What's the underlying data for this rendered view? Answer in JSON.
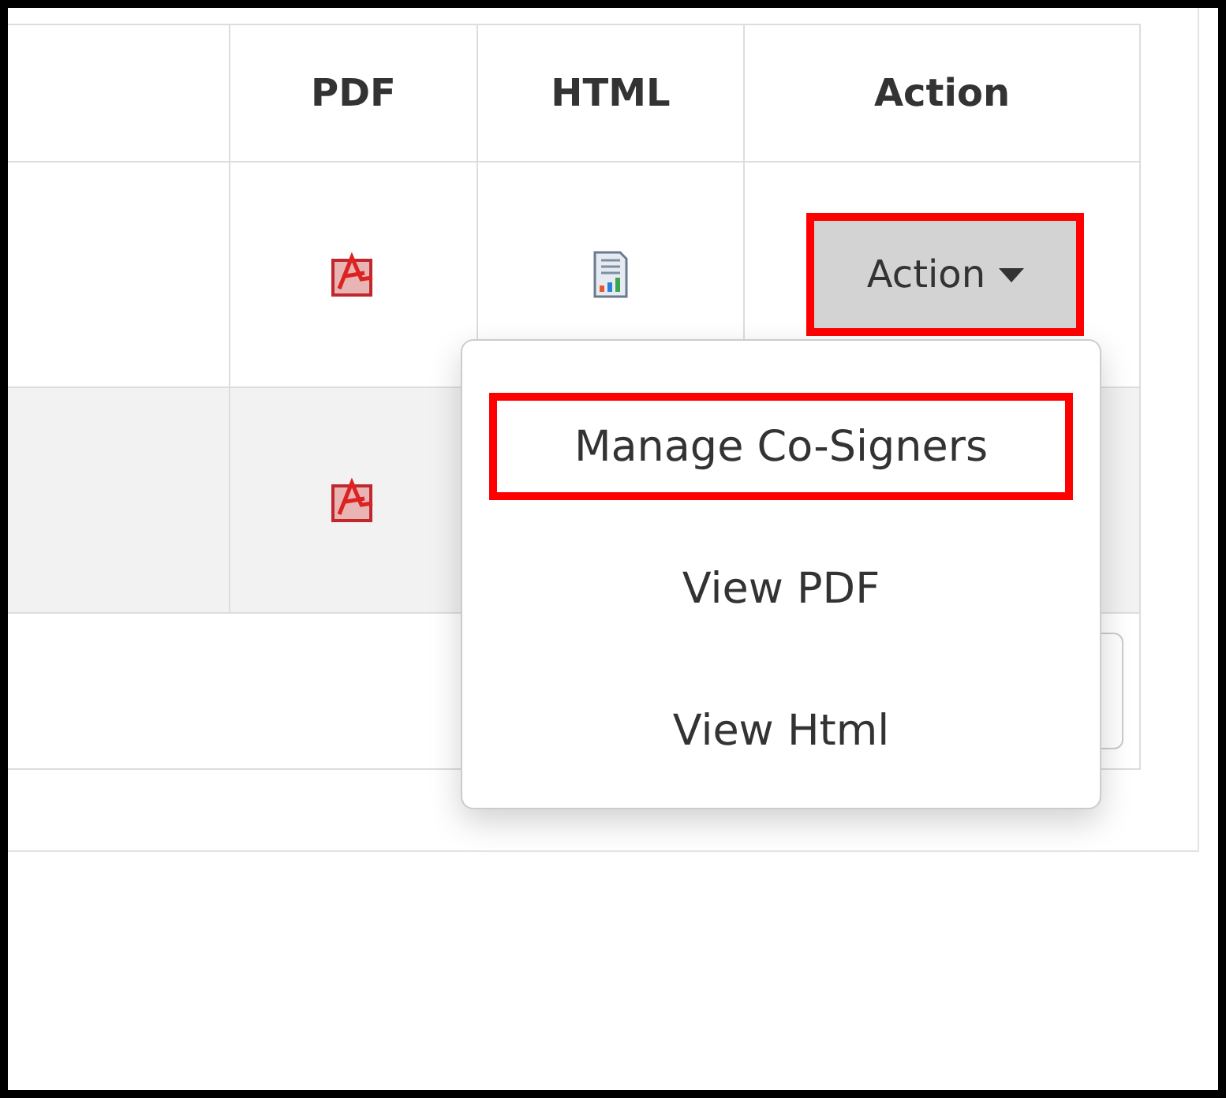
{
  "table": {
    "columns": [
      "PDF",
      "HTML",
      "Action"
    ],
    "rows": [
      {
        "shaded": false,
        "cells": [
          {
            "kind": "pdf"
          },
          {
            "kind": "html"
          },
          {
            "kind": "action",
            "label": "Action",
            "highlighted": true
          }
        ]
      },
      {
        "shaded": true,
        "cells": [
          {
            "kind": "pdf"
          }
        ]
      }
    ]
  },
  "dropdown": {
    "items": [
      {
        "label": "Manage Co-Signers",
        "highlighted": true
      },
      {
        "label": "View PDF",
        "highlighted": false
      },
      {
        "label": "View Html",
        "highlighted": false
      }
    ]
  }
}
